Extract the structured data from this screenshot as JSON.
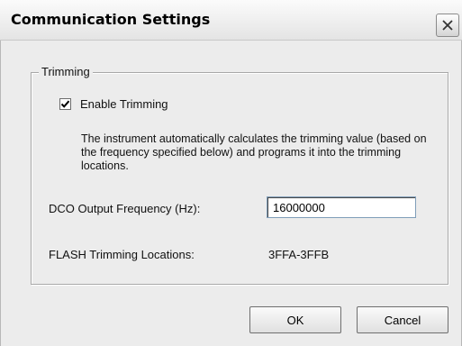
{
  "dialog": {
    "title": "Communication Settings",
    "close_icon": "close-x-icon"
  },
  "trimming_group": {
    "legend": "Trimming",
    "enable_checkbox": {
      "label": "Enable Trimming",
      "checked": true
    },
    "description": "The instrument automatically calculates the trimming value (based on the frequency specified below) and programs it into the trimming locations.",
    "dco_frequency": {
      "label": "DCO Output Frequency (Hz):",
      "value": "16000000"
    },
    "flash_locations": {
      "label": "FLASH Trimming Locations:",
      "value": "3FFA-3FFB"
    }
  },
  "buttons": {
    "ok_label": "OK",
    "cancel_label": "Cancel"
  }
}
